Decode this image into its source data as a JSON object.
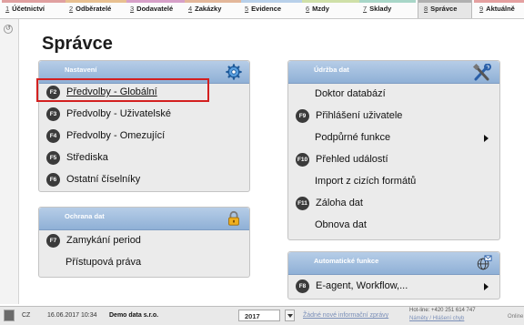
{
  "tabs": [
    {
      "key": "1",
      "label": "Účetnictví",
      "color": "#e0a0a0"
    },
    {
      "key": "2",
      "label": "Odběratelé",
      "color": "#e8c090"
    },
    {
      "key": "3",
      "label": "Dodavatelé",
      "color": "#d6a0c8"
    },
    {
      "key": "4",
      "label": "Zakázky",
      "color": "#e3b79a"
    },
    {
      "key": "5",
      "label": "Evidence",
      "color": "#b8d0ea"
    },
    {
      "key": "6",
      "label": "Mzdy",
      "color": "#cfe0a8"
    },
    {
      "key": "7",
      "label": "Sklady",
      "color": "#a8d6c8"
    },
    {
      "key": "8",
      "label": "Správce",
      "color": "#b0b0b0"
    },
    {
      "key": "9",
      "label": "Aktuálně",
      "color": "#e4a0a0"
    }
  ],
  "page": {
    "title": "Správce"
  },
  "panels": {
    "nastaveni": {
      "title": "Nastavení",
      "icon": "gear-icon",
      "items": [
        {
          "key": "F2",
          "label": "Předvolby - Globální"
        },
        {
          "key": "F3",
          "label": "Předvolby - Uživatelské"
        },
        {
          "key": "F4",
          "label": "Předvolby - Omezující"
        },
        {
          "key": "F5",
          "label": "Střediska"
        },
        {
          "key": "F6",
          "label": "Ostatní číselníky"
        }
      ]
    },
    "ochrana": {
      "title": "Ochrana dat",
      "icon": "lock-icon",
      "items": [
        {
          "key": "F7",
          "label": "Zamykání period"
        },
        {
          "key": "",
          "label": "Přístupová práva"
        }
      ]
    },
    "udrzba": {
      "title": "Údržba dat",
      "icon": "tools-icon",
      "items": [
        {
          "key": "",
          "label": "Doktor databází"
        },
        {
          "key": "F9",
          "label": "Přihlášení uživatele"
        },
        {
          "key": "",
          "label": "Podpůrné funkce"
        },
        {
          "key": "F10",
          "label": "Přehled událostí"
        },
        {
          "key": "",
          "label": "Import z cizích formátů"
        },
        {
          "key": "F11",
          "label": "Záloha dat"
        },
        {
          "key": "",
          "label": "Obnova dat"
        }
      ]
    },
    "automaticke": {
      "title": "Automatické funkce",
      "icon": "globe-mail-icon",
      "items": [
        {
          "key": "F8",
          "label": "E-agent, Workflow,..."
        }
      ]
    }
  },
  "statusbar": {
    "country": "CZ",
    "datetime": "16.06.2017 10:34",
    "company": "Demo data s.r.o.",
    "year": "2017",
    "info": "Žádné nové informační zprávy",
    "hotline": "Hot-line: +420 251 614 747",
    "feedback": "Náměty / Hlášení chyb",
    "online": "Online"
  },
  "colors": {
    "panel_header": "#9fbde0",
    "highlight": "#d32020",
    "badge": "#3b3b3b"
  }
}
